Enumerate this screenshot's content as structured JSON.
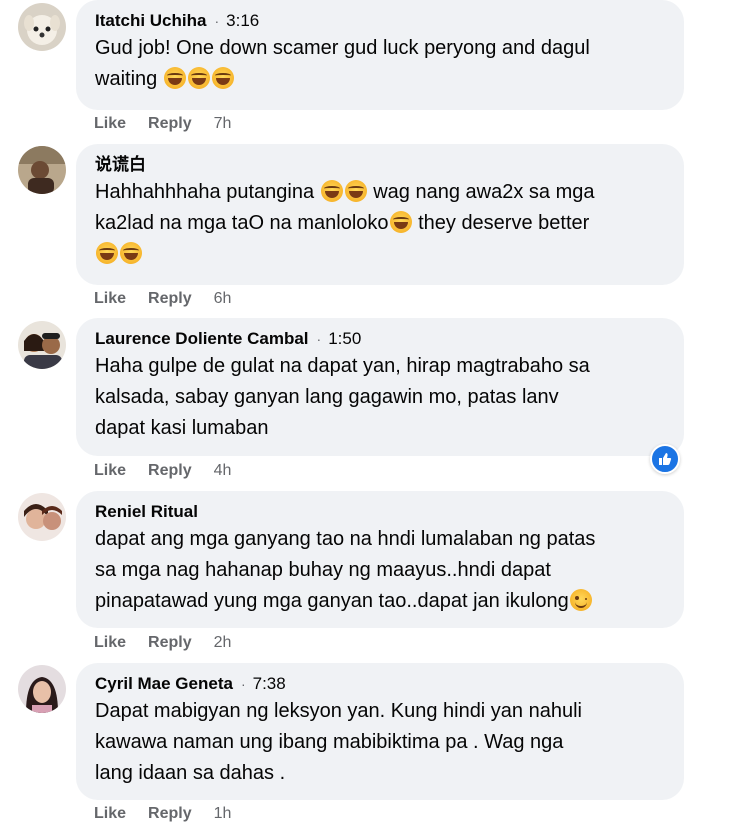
{
  "comments": [
    {
      "author": "Itatchi Uchiha",
      "time": "3:16",
      "lines": [
        "Gud job! One down scamer gud luck peryong and dagul",
        "waiting"
      ],
      "actions": {
        "like": "Like",
        "reply": "Reply",
        "ago": "7h"
      }
    },
    {
      "author": "说谎白",
      "time": "",
      "lines": [
        "Hahhahhhaha putangina",
        "wag nang awa2x sa mga",
        "ka2lad na mga taO na manloloko",
        "they deserve better"
      ],
      "actions": {
        "like": "Like",
        "reply": "Reply",
        "ago": "6h"
      }
    },
    {
      "author": "Laurence Doliente Cambal",
      "time": "1:50",
      "lines": [
        "Haha gulpe de gulat na dapat yan, hirap magtrabaho sa",
        "kalsada, sabay ganyan lang gagawin mo, patas lanv",
        "dapat kasi lumaban"
      ],
      "actions": {
        "like": "Like",
        "reply": "Reply",
        "ago": "4h"
      }
    },
    {
      "author": "Reniel Ritual",
      "time": "",
      "lines": [
        "dapat ang mga ganyang tao na hndi lumalaban ng patas",
        "sa mga nag hahanap buhay ng maayus..hndi dapat",
        "pinapatawad yung mga ganyan tao..dapat jan ikulong"
      ],
      "actions": {
        "like": "Like",
        "reply": "Reply",
        "ago": "2h"
      }
    },
    {
      "author": "Cyril Mae Geneta",
      "time": "7:38",
      "lines": [
        "Dapat mabigyan ng leksyon yan. Kung hindi yan nahuli",
        "kawawa naman ung ibang mabibiktima pa . Wag nga",
        "lang idaan sa dahas ."
      ],
      "actions": {
        "like": "Like",
        "reply": "Reply",
        "ago": "1h"
      }
    }
  ],
  "colors": {
    "bubble": "#f0f2f5",
    "muted": "#65676b",
    "like_blue": "#1b74e4"
  },
  "icons": {
    "reaction": "laughing-emoji-icon",
    "wink": "winking-emoji-icon",
    "like_badge": "thumbs-up-icon"
  }
}
